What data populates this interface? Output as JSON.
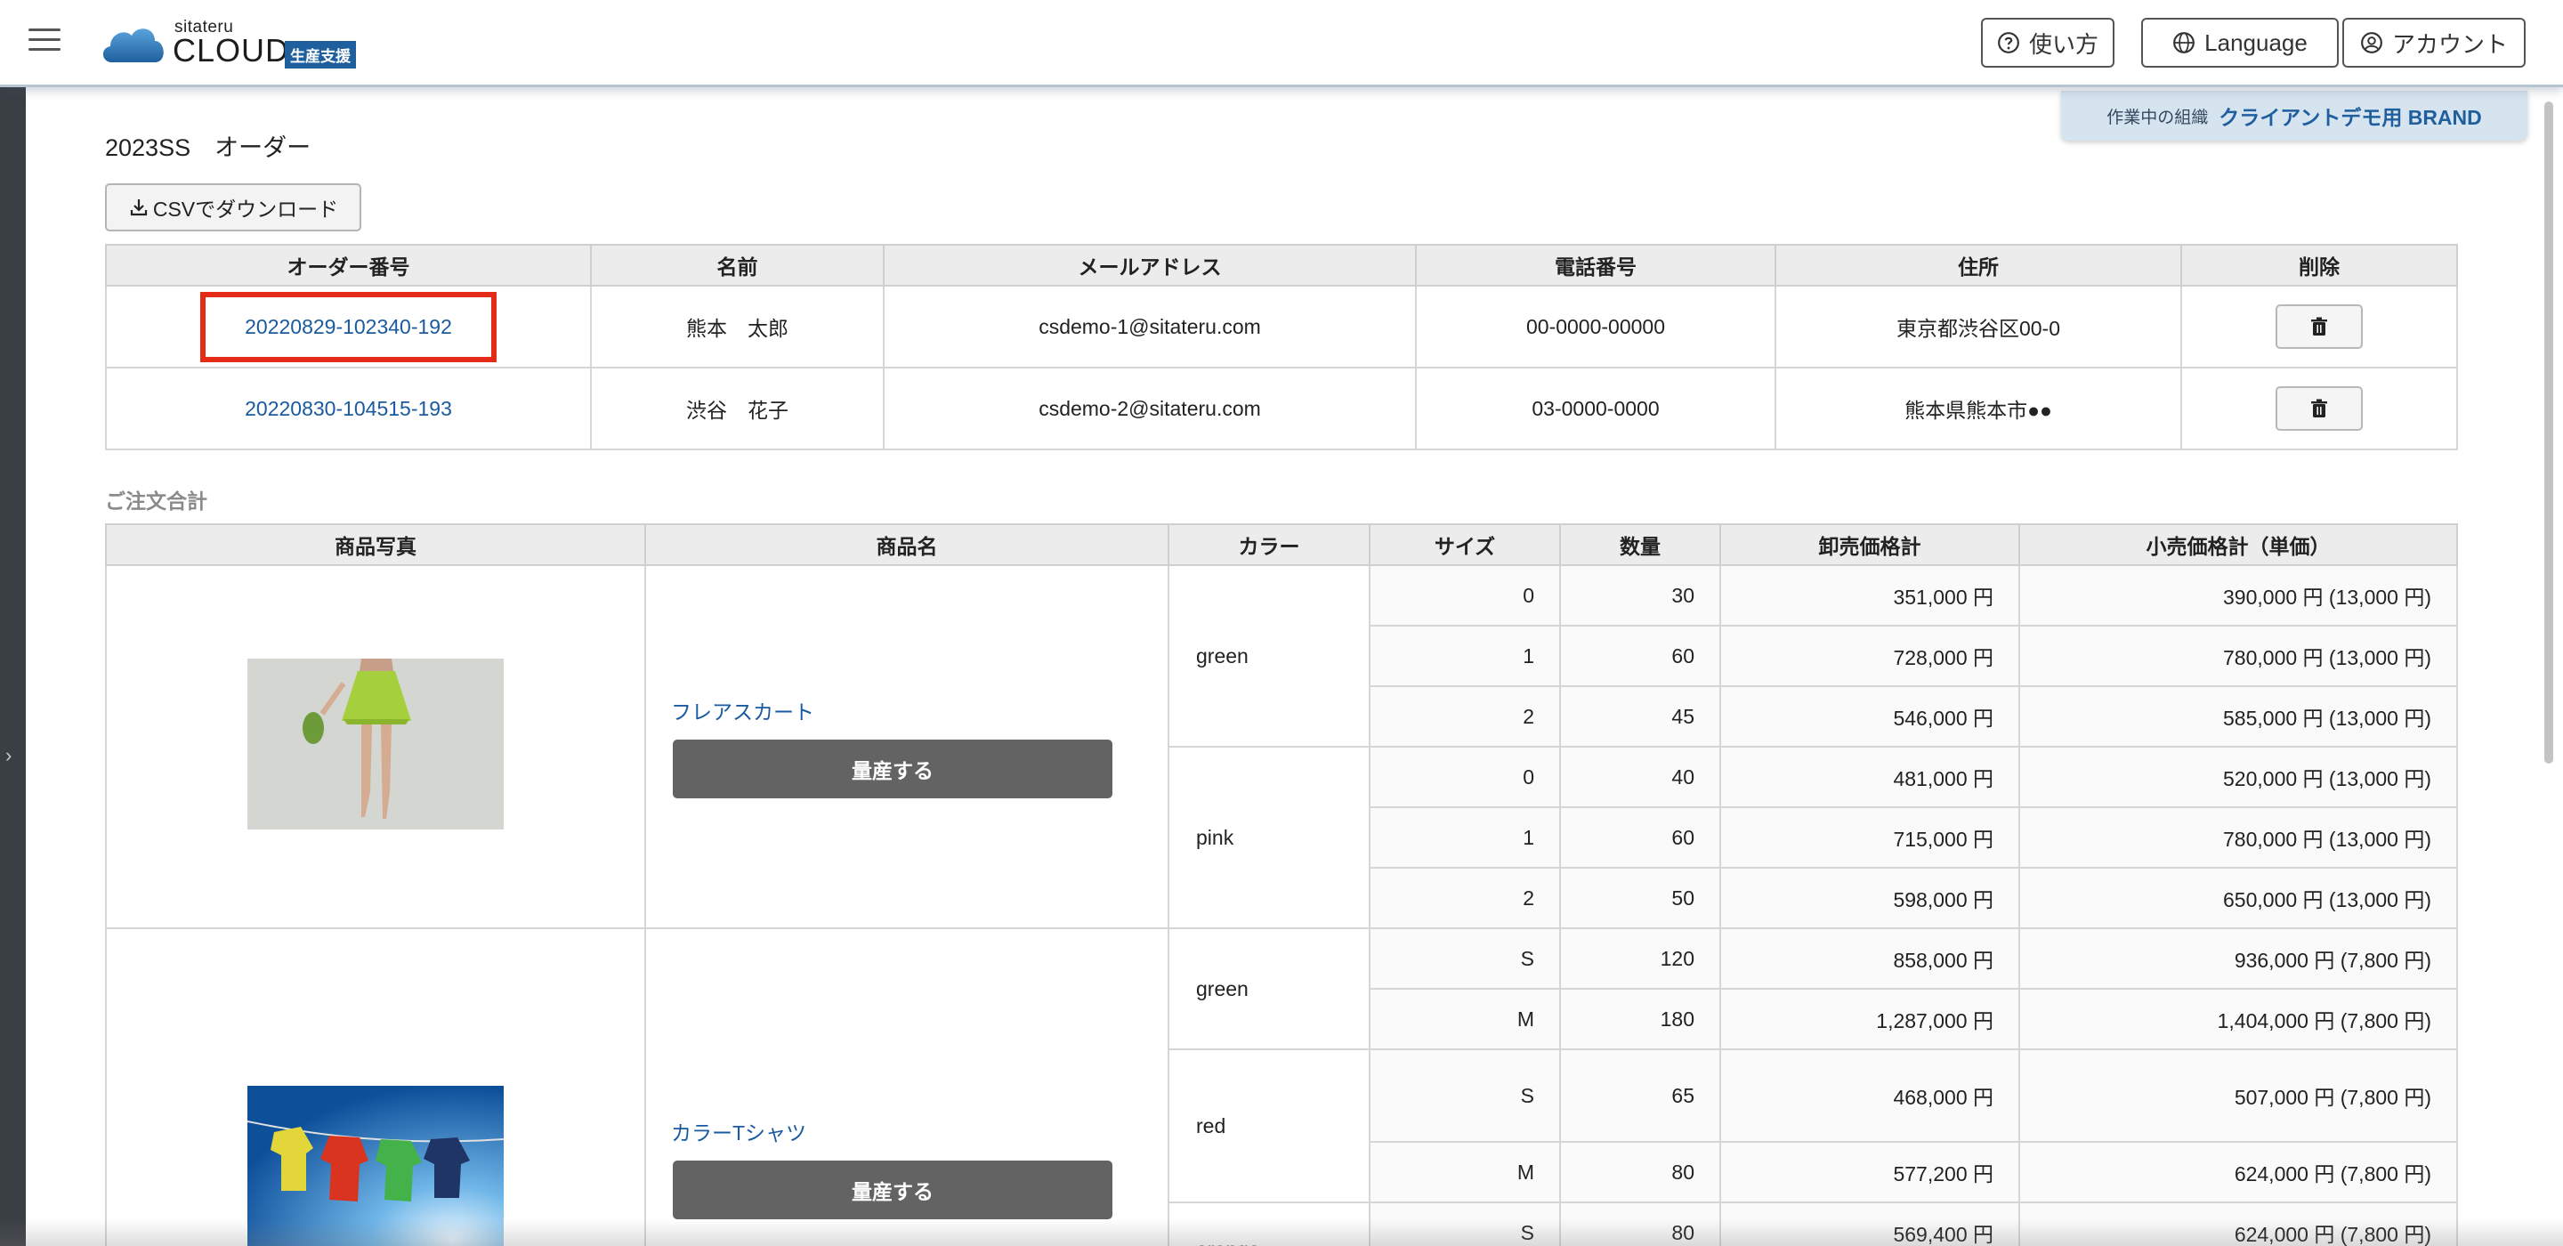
{
  "header": {
    "logo_small": "sitateru",
    "logo_big": "CLOUD",
    "logo_badge": "生産支援",
    "help_label": "使い方",
    "language_label": "Language",
    "account_label": "アカウント"
  },
  "org": {
    "label": "作業中の組織",
    "name": "クライアントデモ用 BRAND"
  },
  "page": {
    "title": "2023SS　オーダー",
    "csv_label": "CSVでダウンロード"
  },
  "orders": {
    "headers": [
      "オーダー番号",
      "名前",
      "メールアドレス",
      "電話番号",
      "住所",
      "削除"
    ],
    "rows": [
      {
        "order_no": "20220829-102340-192",
        "name": "熊本　太郎",
        "email": "csdemo-1@sitateru.com",
        "phone": "00-0000-00000",
        "address": "東京都渋谷区00-0"
      },
      {
        "order_no": "20220830-104515-193",
        "name": "渋谷　花子",
        "email": "csdemo-2@sitateru.com",
        "phone": "03-0000-0000",
        "address": "熊本県熊本市●●"
      }
    ]
  },
  "summary": {
    "label": "ご注文合計",
    "headers": [
      "商品写真",
      "商品名",
      "カラー",
      "サイズ",
      "数量",
      "卸売価格計",
      "小売価格計（単価）"
    ],
    "mass_button_label": "量産する",
    "products": [
      {
        "name": "フレアスカート",
        "photo_icon": "green-skirt-photo",
        "colors": [
          {
            "color": "green",
            "rows": [
              {
                "size": "0",
                "qty": "30",
                "wholesale": "351,000 円",
                "retail": "390,000 円 (13,000 円)"
              },
              {
                "size": "1",
                "qty": "60",
                "wholesale": "728,000 円",
                "retail": "780,000 円 (13,000 円)"
              },
              {
                "size": "2",
                "qty": "45",
                "wholesale": "546,000 円",
                "retail": "585,000 円 (13,000 円)"
              }
            ]
          },
          {
            "color": "pink",
            "rows": [
              {
                "size": "0",
                "qty": "40",
                "wholesale": "481,000 円",
                "retail": "520,000 円 (13,000 円)"
              },
              {
                "size": "1",
                "qty": "60",
                "wholesale": "715,000 円",
                "retail": "780,000 円 (13,000 円)"
              },
              {
                "size": "2",
                "qty": "50",
                "wholesale": "598,000 円",
                "retail": "650,000 円 (13,000 円)"
              }
            ]
          }
        ]
      },
      {
        "name": "カラーTシャツ",
        "photo_icon": "tshirts-clothesline-photo",
        "colors": [
          {
            "color": "green",
            "rows": [
              {
                "size": "S",
                "qty": "120",
                "wholesale": "858,000 円",
                "retail": "936,000 円 (7,800 円)"
              },
              {
                "size": "M",
                "qty": "180",
                "wholesale": "1,287,000 円",
                "retail": "1,404,000 円 (7,800 円)"
              }
            ]
          },
          {
            "color": "red",
            "rows": [
              {
                "size": "S",
                "qty": "65",
                "wholesale": "468,000 円",
                "retail": "507,000 円 (7,800 円)"
              },
              {
                "size": "M",
                "qty": "80",
                "wholesale": "577,200 円",
                "retail": "624,000 円 (7,800 円)"
              }
            ]
          },
          {
            "color": "orange",
            "rows": [
              {
                "size": "S",
                "qty": "80",
                "wholesale": "569,400 円",
                "retail": "624,000 円 (7,800 円)"
              }
            ]
          }
        ]
      }
    ]
  },
  "colors": {
    "brand_blue": "#1f5f9e",
    "link_blue": "#1a5aa0",
    "highlight_red": "#e62a18",
    "rail_dark": "#3a3f44",
    "button_gray": "#636363"
  }
}
